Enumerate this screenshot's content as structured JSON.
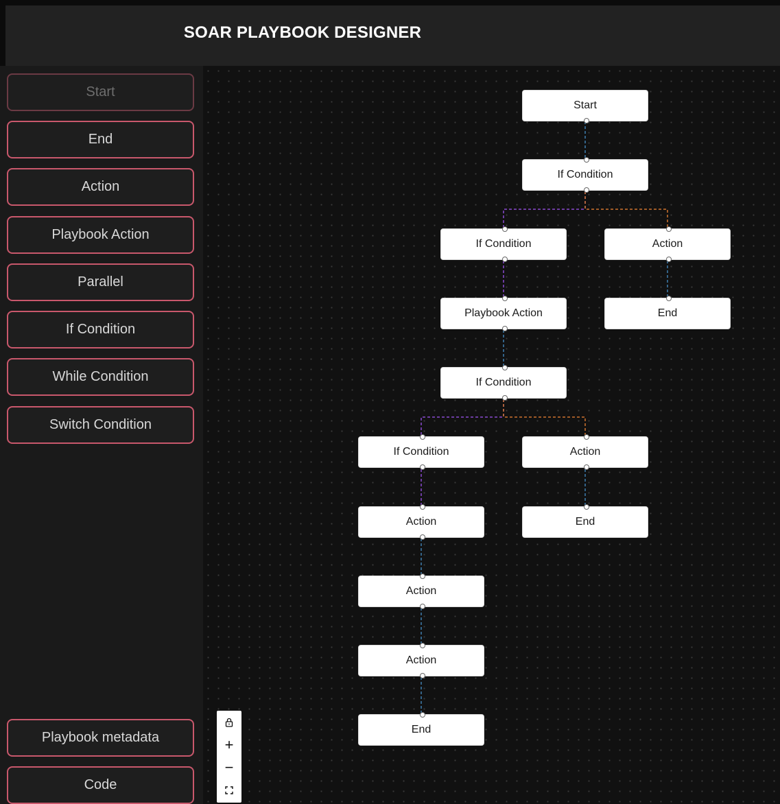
{
  "header": {
    "title": "SOAR PLAYBOOK DESIGNER"
  },
  "sidebar": {
    "items": [
      {
        "label": "Start",
        "disabled": true
      },
      {
        "label": "End"
      },
      {
        "label": "Action"
      },
      {
        "label": "Playbook Action"
      },
      {
        "label": "Parallel"
      },
      {
        "label": "If Condition"
      },
      {
        "label": "While Condition"
      },
      {
        "label": "Switch Condition"
      }
    ],
    "bottom": [
      {
        "label": "Playbook metadata"
      },
      {
        "label": "Code"
      }
    ]
  },
  "canvas": {
    "nodes": [
      {
        "id": "n1",
        "label": "Start"
      },
      {
        "id": "n2",
        "label": "If Condition"
      },
      {
        "id": "n3",
        "label": "If Condition"
      },
      {
        "id": "n4",
        "label": "Action"
      },
      {
        "id": "n5",
        "label": "Playbook Action"
      },
      {
        "id": "n6",
        "label": "End"
      },
      {
        "id": "n7",
        "label": "If Condition"
      },
      {
        "id": "n8",
        "label": "If Condition"
      },
      {
        "id": "n9",
        "label": "Action"
      },
      {
        "id": "n10",
        "label": "Action"
      },
      {
        "id": "n11",
        "label": "End"
      },
      {
        "id": "n12",
        "label": "Action"
      },
      {
        "id": "n13",
        "label": "Action"
      },
      {
        "id": "n14",
        "label": "End"
      }
    ]
  },
  "controls": {
    "lock_icon": "lock-icon",
    "zoom_in": "+",
    "zoom_out": "−",
    "fit_icon": "fit-view-icon"
  },
  "colors": {
    "accent": "#c9586c",
    "edge_default": "#3f7fb0",
    "edge_true": "#8a4bd1",
    "edge_false": "#d0742f"
  }
}
